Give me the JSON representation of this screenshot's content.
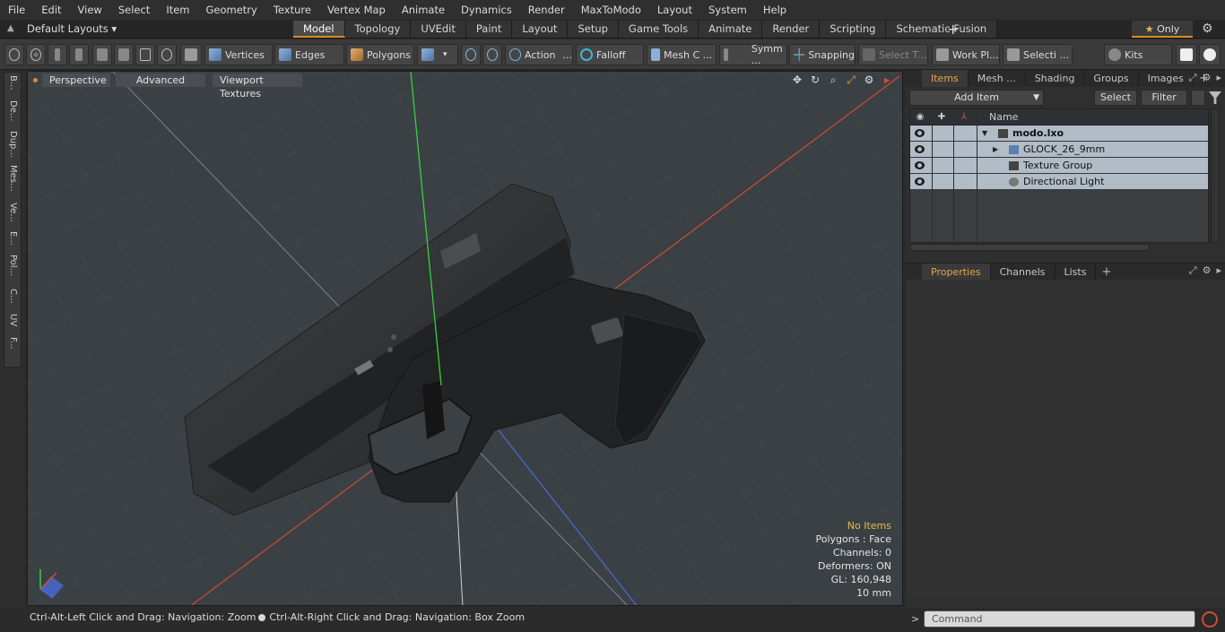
{
  "menu": [
    "File",
    "Edit",
    "View",
    "Select",
    "Item",
    "Geometry",
    "Texture",
    "Vertex Map",
    "Animate",
    "Dynamics",
    "Render",
    "MaxToModo",
    "Layout",
    "System",
    "Help"
  ],
  "layout": {
    "default_layouts": "Default Layouts",
    "tabs": [
      "Model",
      "Topology",
      "UVEdit",
      "Paint",
      "Layout",
      "Setup",
      "Game Tools",
      "Animate",
      "Render",
      "Scripting",
      "Schematic Fusion"
    ],
    "active_tab": "Model",
    "only_label": "Only"
  },
  "toolbar": {
    "vertices": "Vertices",
    "edges": "Edges",
    "polygons": "Polygons",
    "action": "Action",
    "falloff": "Falloff",
    "mesh_c": "Mesh C ...",
    "symm": "Symm ...",
    "snapping": "Snapping",
    "select_t": "Select T...",
    "work_pl": "Work Pl...",
    "selecti": "Selecti ...",
    "kits": "Kits"
  },
  "left_tabs": [
    "B...",
    "De...",
    "Dup...",
    "Mes...",
    "Ve...",
    "E...",
    "Pol...",
    "C...",
    "UV",
    "F..."
  ],
  "viewport": {
    "perspective": "Perspective",
    "advanced": "Advanced",
    "viewport_textures": "Viewport Textures",
    "stats": {
      "no_items": "No Items",
      "polygons": "Polygons : Face",
      "channels": "Channels: 0",
      "deformers": "Deformers: ON",
      "gl": "GL: 160,948",
      "scale": "10 mm"
    }
  },
  "status": {
    "left": "Ctrl-Alt-Left Click and Drag: Navigation: Zoom",
    "right": "Ctrl-Alt-Right Click and Drag: Navigation: Box Zoom"
  },
  "items_panel": {
    "tabs": [
      "Items",
      "Mesh ...",
      "Shading",
      "Groups",
      "Images"
    ],
    "active_tab": "Items",
    "add_item": "Add Item",
    "select": "Select",
    "filter": "Filter",
    "name_header": "Name",
    "rows": [
      {
        "label": "modo.lxo"
      },
      {
        "label": "GLOCK_26_9mm"
      },
      {
        "label": "Texture Group"
      },
      {
        "label": "Directional Light"
      }
    ]
  },
  "props_panel": {
    "tabs": [
      "Properties",
      "Channels",
      "Lists"
    ],
    "active_tab": "Properties"
  },
  "command": {
    "placeholder": "Command"
  },
  "colors": {
    "accent": "#d88a2c",
    "viewport_bg": "#3b4045",
    "stats_highlight": "#e7bd3c"
  }
}
